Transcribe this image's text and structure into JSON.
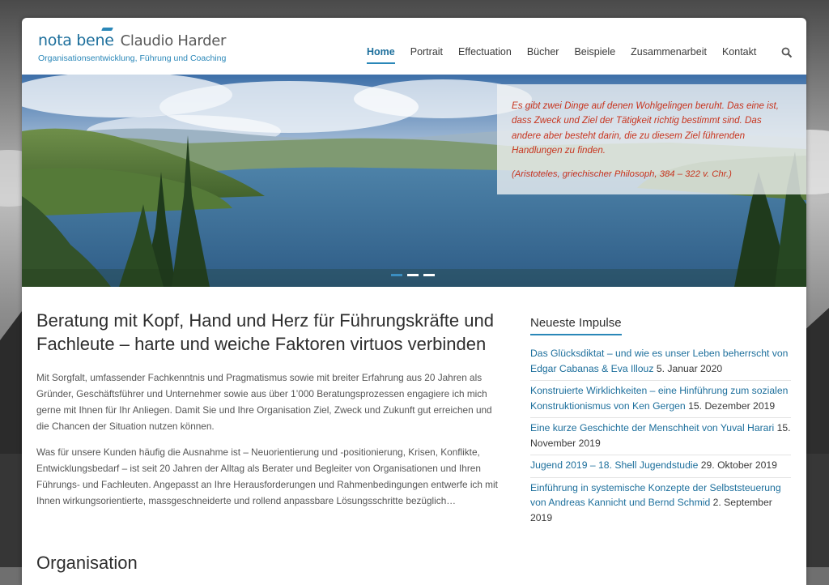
{
  "logo": {
    "brand": "nota bene",
    "name": "Claudio Harder",
    "tagline": "Organisationsentwicklung, Führung und Coaching"
  },
  "nav": {
    "items": [
      {
        "label": "Home",
        "active": true
      },
      {
        "label": "Portrait"
      },
      {
        "label": "Effectuation"
      },
      {
        "label": "Bücher"
      },
      {
        "label": "Beispiele"
      },
      {
        "label": "Zusammenarbeit"
      },
      {
        "label": "Kontakt"
      }
    ],
    "search_icon": "search-icon"
  },
  "hero": {
    "quote": "Es gibt zwei Dinge auf denen Wohlgelingen beruht. Das eine ist, dass Zweck und Ziel der Tätigkeit richtig bestimmt sind. Das andere aber besteht darin, die zu diesem Ziel führenden Handlungen zu finden.",
    "source": "(Aristoteles, griechischer Philosoph, 384 – 322 v. Chr.)",
    "slides": 3,
    "active_slide": 1
  },
  "main": {
    "heading": "Beratung mit Kopf, Hand und Herz für Führungskräfte und Fachleute – harte und weiche Faktoren virtuos verbinden",
    "paragraphs": [
      "Mit Sorgfalt, umfassender Fachkenntnis und Pragmatismus sowie mit breiter Erfahrung aus 20 Jahren als Gründer, Geschäftsführer und Unternehmer sowie aus über 1’000 Beratungsprozessen engagiere ich mich gerne mit Ihnen für Ihr Anliegen. Damit Sie und Ihre Organisation Ziel, Zweck und Zukunft gut erreichen und die Chancen der Situation nutzen können.",
      "Was für unsere Kunden häufig die Ausnahme ist – Neuorientierung und -positionierung, Krisen, Konflikte, Entwicklungsbedarf – ist seit 20 Jahren der Alltag als Berater und Begleiter von Organisationen und Ihren Führungs- und Fachleuten. Angepasst an Ihre Herausforderungen und Rahmenbedingungen entwerfe ich mit Ihnen wirkungsorientierte, massgeschneiderte und rollend anpassbare Lösungsschritte bezüglich…"
    ],
    "section_heading": "Organisation"
  },
  "sidebar": {
    "title": "Neueste Impulse",
    "posts": [
      {
        "title": "Das Glücksdiktat – und wie es unser Leben beherrscht von Edgar Cabanas & Eva Illouz",
        "date": "5. Januar 2020"
      },
      {
        "title": "Konstruierte Wirklichkeiten – eine Hinführung zum sozialen Konstruktionismus von Ken Gergen",
        "date": "15. Dezember 2019"
      },
      {
        "title": "Eine kurze Geschichte der Menschheit von Yuval Harari",
        "date": "15. November 2019"
      },
      {
        "title": "Jugend 2019 – 18. Shell Jugendstudie",
        "date": "29. Oktober 2019"
      },
      {
        "title": "Einführung in systemische Konzepte der Selbststeuerung von Andreas Kannicht und Bernd Schmid",
        "date": "2. September 2019"
      }
    ]
  },
  "colors": {
    "brand_blue": "#1d6f9c",
    "accent_blue": "#2a87b8",
    "quote_red": "#c7341e"
  }
}
